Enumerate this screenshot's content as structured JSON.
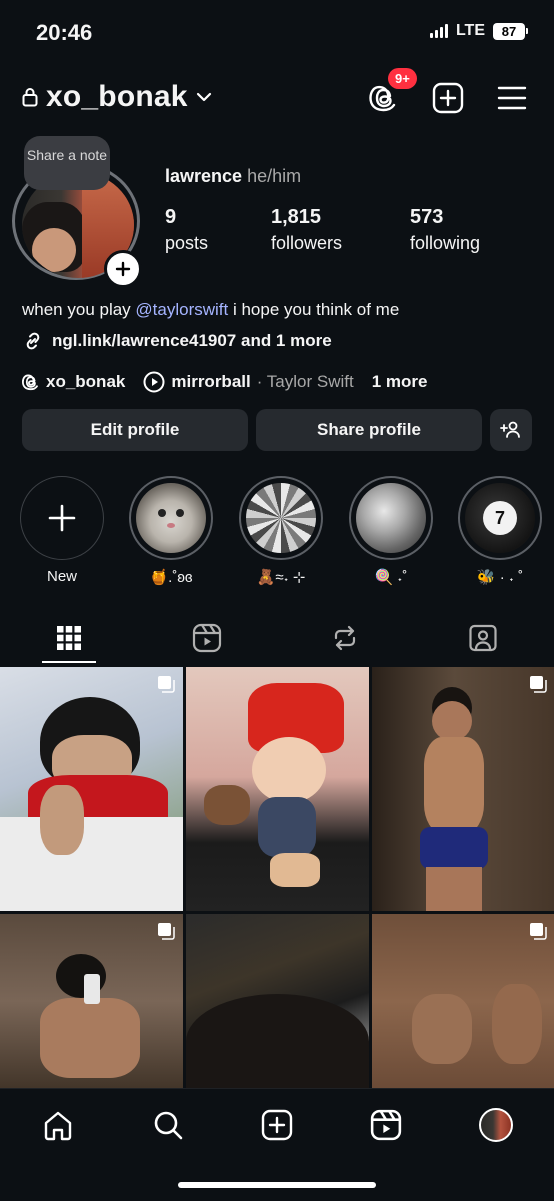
{
  "status": {
    "time": "20:46",
    "network": "LTE",
    "battery": "87"
  },
  "header": {
    "username": "xo_bonak",
    "threads_badge": "9+"
  },
  "profile": {
    "note": "Share a note",
    "name": "lawrence",
    "pronouns": "he/him",
    "stats": [
      {
        "num": "9",
        "label": "posts"
      },
      {
        "num": "1,815",
        "label": "followers"
      },
      {
        "num": "573",
        "label": "following"
      }
    ],
    "bio_prefix": "when you play ",
    "bio_mention": "@taylorswift",
    "bio_suffix": " i hope you think of me",
    "link": "ngl.link/lawrence41907 and 1 more",
    "threads_handle": "xo_bonak",
    "song": "mirrorball",
    "artist": "· Taylor Swift",
    "more": "1 more"
  },
  "buttons": {
    "edit": "Edit profile",
    "share": "Share profile"
  },
  "highlights": [
    {
      "label": "New"
    },
    {
      "label": "🍯.˚ʚɞ"
    },
    {
      "label": "🧸≈˖ ⊹"
    },
    {
      "label": "🍭 ˖˚"
    },
    {
      "label": "🐝 · ˖ ˚"
    }
  ],
  "colors": {
    "background": "#0c1014",
    "button": "#262a2f",
    "mention": "#a5b4ff",
    "badge": "#ff3040"
  }
}
